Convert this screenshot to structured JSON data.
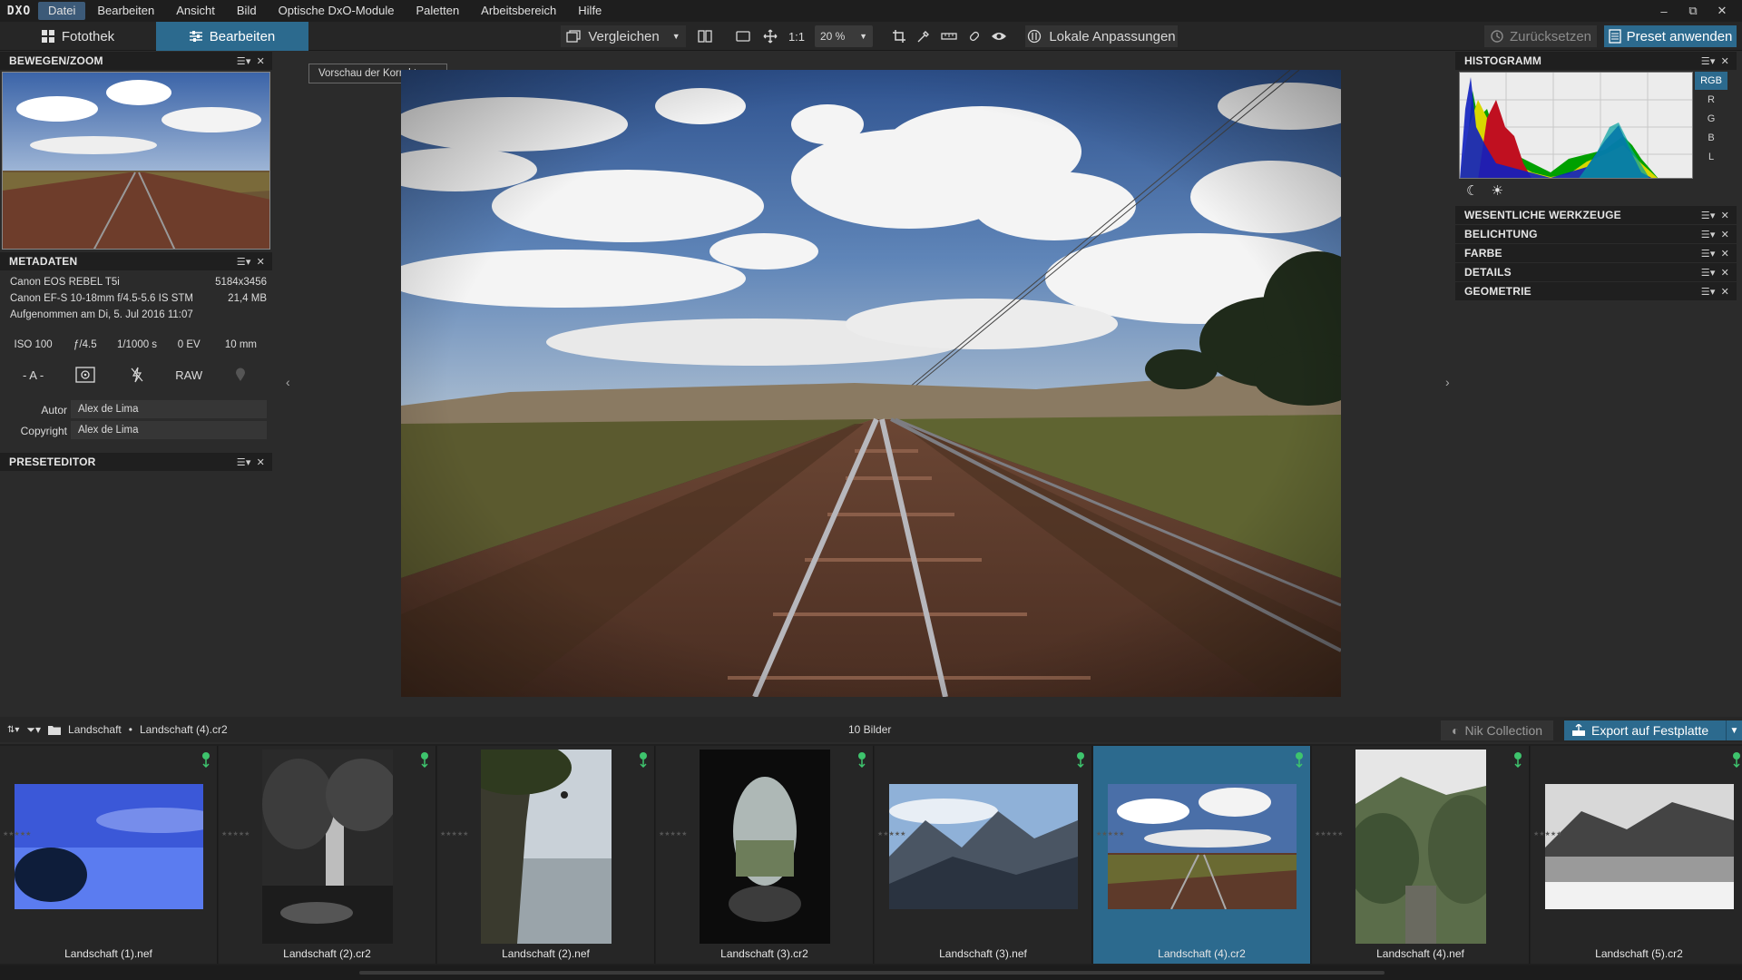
{
  "app": {
    "logo": "DXO",
    "menu": [
      "Datei",
      "Bearbeiten",
      "Ansicht",
      "Bild",
      "Optische DxO-Module",
      "Paletten",
      "Arbeitsbereich",
      "Hilfe"
    ],
    "window_controls": [
      "–",
      "⧉",
      "✕"
    ]
  },
  "toolbar": {
    "tab_library": "Fotothek",
    "tab_edit": "Bearbeiten",
    "compare_label": "Vergleichen",
    "one_to_one": "1:1",
    "zoom_value": "20 %",
    "local_adjustments": "Lokale Anpassungen",
    "reset": "Zurücksetzen",
    "apply_preset": "Preset anwenden"
  },
  "left_panel": {
    "nav_title": "BEWEGEN/ZOOM",
    "meta_title": "METADATEN",
    "camera": "Canon EOS REBEL T5i",
    "resolution": "5184x3456",
    "lens": "Canon EF-S 10-18mm f/4.5-5.6 IS STM",
    "filesize": "21,4 MB",
    "taken": "Aufgenommen am Di, 5. Jul 2016 11:07",
    "exif": [
      "ISO 100",
      "ƒ/4.5",
      "1/1000 s",
      "0 EV",
      "10 mm"
    ],
    "mode": "- A -",
    "raw": "RAW",
    "author_label": "Autor",
    "author": "Alex de Lima",
    "copyright_label": "Copyright",
    "copyright": "Alex de Lima",
    "preset_title": "PRESETEDITOR"
  },
  "viewer": {
    "tooltip": "Vorschau der Korrekturen"
  },
  "right_panel": {
    "histogram_title": "HISTOGRAMM",
    "channels": [
      "RGB",
      "R",
      "G",
      "B",
      "L"
    ],
    "active_channel": "RGB",
    "sections": [
      "WESENTLICHE WERKZEUGE",
      "BELICHTUNG",
      "FARBE",
      "DETAILS",
      "GEOMETRIE"
    ]
  },
  "filmstrip_bar": {
    "folder": "Landschaft",
    "separator": "•",
    "file": "Landschaft (4).cr2",
    "count": "10 Bilder",
    "nik": "Nik Collection",
    "export": "Export auf Festplatte"
  },
  "filmstrip": {
    "selected_index": 5,
    "items": [
      {
        "name": "Landschaft (1).nef",
        "kind": "blue-lake"
      },
      {
        "name": "Landschaft (2).cr2",
        "kind": "waterfall"
      },
      {
        "name": "Landschaft (2).nef",
        "kind": "cliff-jump"
      },
      {
        "name": "Landschaft (3).cr2",
        "kind": "cave"
      },
      {
        "name": "Landschaft (3).nef",
        "kind": "mountains"
      },
      {
        "name": "Landschaft (4).cr2",
        "kind": "railway"
      },
      {
        "name": "Landschaft (4).nef",
        "kind": "forest-path"
      },
      {
        "name": "Landschaft (5).cr2",
        "kind": "snow-lake"
      }
    ]
  },
  "colors": {
    "accent": "#2c6a8e",
    "panel": "#2b2b2b",
    "header": "#1f1f1f"
  }
}
